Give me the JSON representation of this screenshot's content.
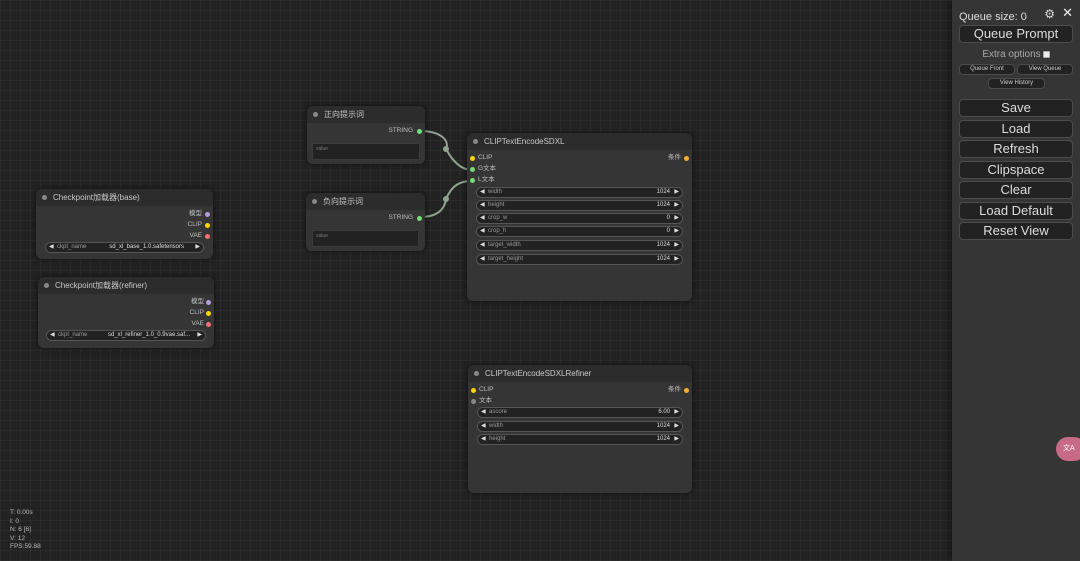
{
  "nodes": {
    "ckpt_base": {
      "title": "Checkpoint加载器(base)",
      "outputs": [
        "模型",
        "CLIP",
        "VAE"
      ],
      "widget": {
        "name": "ckpt_name",
        "value": "sd_xl_base_1.0.safetensors"
      }
    },
    "ckpt_refiner": {
      "title": "Checkpoint加载器(refiner)",
      "outputs": [
        "模型",
        "CLIP",
        "VAE"
      ],
      "widget": {
        "name": "ckpt_name",
        "value": "sd_xl_refiner_1.0_0.9vae.saf..."
      }
    },
    "positive": {
      "title": "正向提示词",
      "output": "STRING",
      "placeholder": "value"
    },
    "negative": {
      "title": "负向提示词",
      "output": "STRING",
      "placeholder": "value"
    },
    "sdxl": {
      "title": "CLIPTextEncodeSDXL",
      "inputs": [
        "CLIP",
        "G文本",
        "L文本"
      ],
      "output": "条件",
      "widgets": [
        {
          "name": "width",
          "value": "1024"
        },
        {
          "name": "height",
          "value": "1024"
        },
        {
          "name": "crop_w",
          "value": "0"
        },
        {
          "name": "crop_h",
          "value": "0"
        },
        {
          "name": "target_width",
          "value": "1024"
        },
        {
          "name": "target_height",
          "value": "1024"
        }
      ]
    },
    "refiner": {
      "title": "CLIPTextEncodeSDXLRefiner",
      "inputs": [
        "CLIP",
        "文本"
      ],
      "output": "条件",
      "widgets": [
        {
          "name": "ascore",
          "value": "6.00"
        },
        {
          "name": "width",
          "value": "1024"
        },
        {
          "name": "height",
          "value": "1024"
        }
      ]
    }
  },
  "panel": {
    "queue_size": "Queue size: 0",
    "queue_prompt": "Queue Prompt",
    "extra_options": "Extra options",
    "queue_front": "Queue Front",
    "view_queue": "View Queue",
    "view_history": "View History",
    "buttons": [
      "Save",
      "Load",
      "Refresh",
      "Clipspace",
      "Clear",
      "Load Default",
      "Reset View"
    ]
  },
  "stats": [
    "T: 0.00s",
    "I: 0",
    "N: 6 [6]",
    "V: 12",
    "FPS:59.88"
  ],
  "icons": {
    "settings": "gear-icon",
    "close": "close-icon",
    "translate": "translate-icon"
  },
  "colors": {
    "clip_slot": "#ffd500",
    "string_slot": "#77dd77",
    "model_slot": "#b39ddb",
    "vae_slot": "#ff6e6e",
    "cond_slot": "#ffa931",
    "link": "#8fa58f"
  }
}
